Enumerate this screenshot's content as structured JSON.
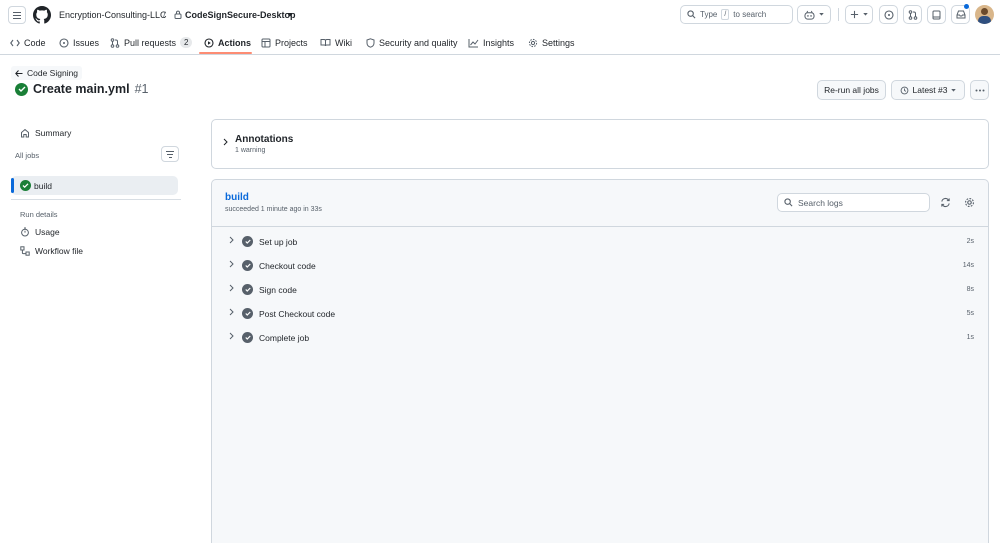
{
  "header": {
    "org": "Encryption-Consulting-LLC",
    "separator": "/",
    "repo": "CodeSignSecure-Desktop",
    "search_placeholder": "Type",
    "search_key": "/",
    "search_suffix": "to search"
  },
  "nav": {
    "code": "Code",
    "issues": "Issues",
    "pulls": "Pull requests",
    "pulls_count": "2",
    "actions": "Actions",
    "projects": "Projects",
    "wiki": "Wiki",
    "security": "Security and quality",
    "insights": "Insights",
    "settings": "Settings"
  },
  "run": {
    "back_label": "Code Signing",
    "title": "Create main.yml",
    "number": "#1",
    "rerun_label": "Re-run all jobs",
    "latest_label": "Latest #3"
  },
  "sidebar": {
    "summary": "Summary",
    "all_jobs": "All jobs",
    "job": "build",
    "run_details": "Run details",
    "usage": "Usage",
    "workflow_file": "Workflow file"
  },
  "annotations": {
    "title": "Annotations",
    "subtitle": "1 warning"
  },
  "job": {
    "title": "build",
    "subtitle": "succeeded 1 minute ago in 33s",
    "search_placeholder": "Search logs",
    "steps": [
      {
        "label": "Set up job",
        "time": "2s"
      },
      {
        "label": "Checkout code",
        "time": "14s"
      },
      {
        "label": "Sign code",
        "time": "8s"
      },
      {
        "label": "Post Checkout code",
        "time": "5s"
      },
      {
        "label": "Complete job",
        "time": "1s"
      }
    ]
  },
  "colors": {
    "accent": "#0969da",
    "success": "#1a7f37",
    "nav_underline": "#fd8c73"
  }
}
